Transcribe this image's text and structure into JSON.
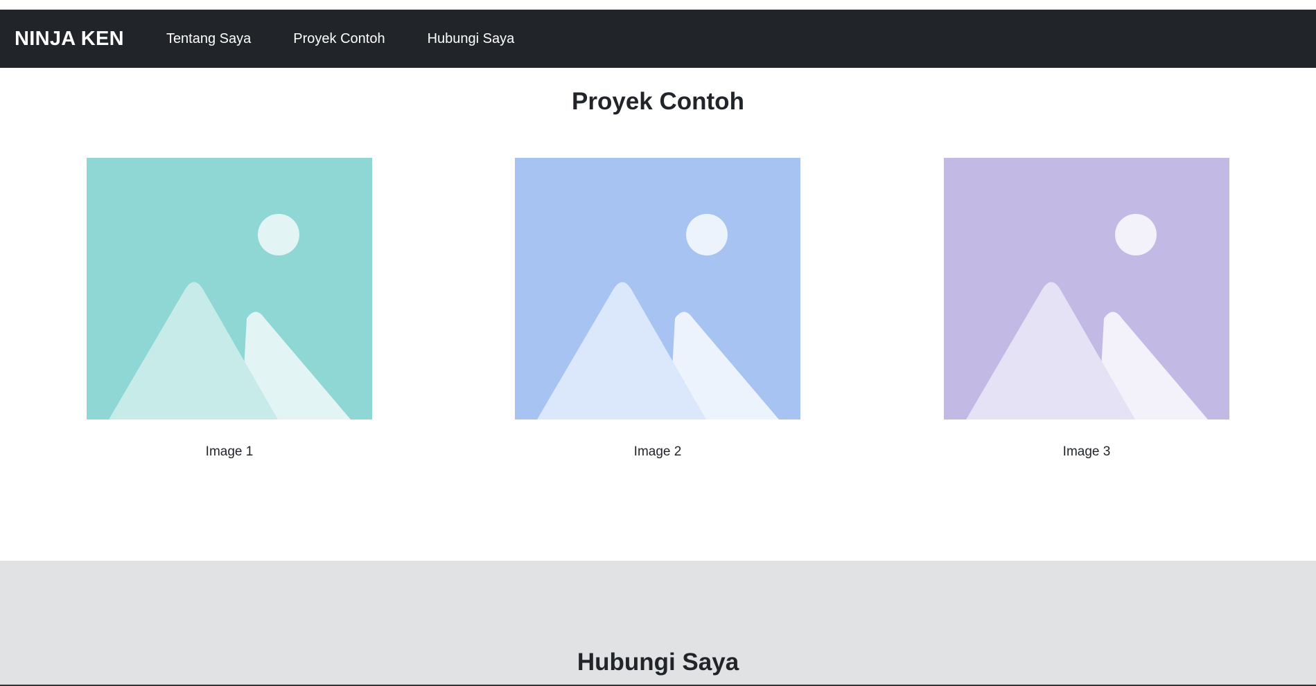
{
  "navbar": {
    "brand": "NINJA KEN",
    "links": [
      "Tentang Saya",
      "Proyek Contoh",
      "Hubungi Saya"
    ]
  },
  "projects": {
    "title": "Proyek Contoh",
    "cards": [
      {
        "caption": "Image 1",
        "icon": "image-placeholder-icon",
        "bg": "#8fd7d4",
        "back_mountain": "#c7ebe9",
        "front_mountain": "#e2f4f3",
        "sun": "#e2f4f3"
      },
      {
        "caption": "Image 2",
        "icon": "image-placeholder-icon",
        "bg": "#a6c3f2",
        "back_mountain": "#dbe7fa",
        "front_mountain": "#edf3fc",
        "sun": "#edf3fc"
      },
      {
        "caption": "Image 3",
        "icon": "image-placeholder-icon",
        "bg": "#c3b9e5",
        "back_mountain": "#e6e2f5",
        "front_mountain": "#f3f1fa",
        "sun": "#f3f1fa"
      }
    ]
  },
  "contact": {
    "title": "Hubungi Saya",
    "bg": "#e1e2e4"
  }
}
